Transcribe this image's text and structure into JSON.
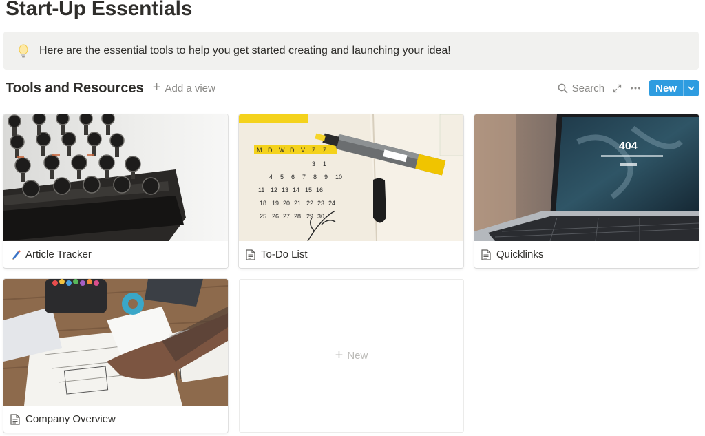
{
  "page": {
    "title": "Start-Up Essentials"
  },
  "callout": {
    "icon": "lightbulb-icon",
    "text": "Here are the essential tools to help you get started creating and launching your idea!"
  },
  "database": {
    "title": "Tools and Resources",
    "add_view_label": "Add a view",
    "search_label": "Search",
    "new_button_label": "New",
    "accent_color": "#2e9ce0"
  },
  "cards": [
    {
      "title": "Article Tracker",
      "icon": "pen-icon",
      "cover": "typewriter"
    },
    {
      "title": "To-Do List",
      "icon": "page-icon",
      "cover": "calendar-notebook"
    },
    {
      "title": "Quicklinks",
      "icon": "page-icon",
      "cover": "laptop-404"
    },
    {
      "title": "Company Overview",
      "icon": "page-icon",
      "cover": "sketch-desk"
    }
  ],
  "cover_texts": {
    "laptop_error": "404"
  },
  "new_card_label": "New"
}
